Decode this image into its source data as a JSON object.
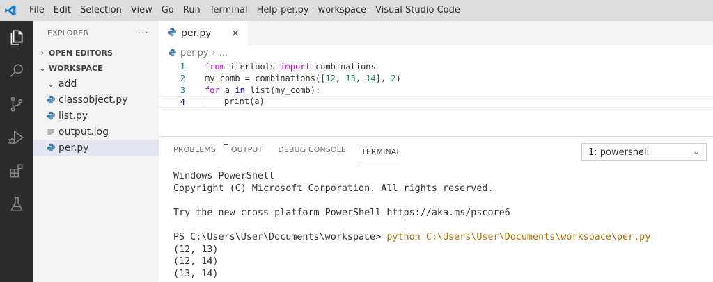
{
  "window": {
    "title": "per.py - workspace - Visual Studio Code",
    "menu": [
      "File",
      "Edit",
      "Selection",
      "View",
      "Go",
      "Run",
      "Terminal",
      "Help"
    ]
  },
  "activity_bar": {
    "icons": [
      "explorer-icon",
      "search-icon",
      "source-control-icon",
      "run-debug-icon",
      "extensions-icon",
      "testing-icon"
    ]
  },
  "sidebar": {
    "title": "EXPLORER",
    "more": "···",
    "open_editors": "OPEN EDITORS",
    "workspace": "WORKSPACE",
    "items": [
      {
        "label": "add",
        "kind": "folder"
      },
      {
        "label": "classobject.py",
        "kind": "python"
      },
      {
        "label": "list.py",
        "kind": "python"
      },
      {
        "label": "output.log",
        "kind": "log"
      },
      {
        "label": "per.py",
        "kind": "python",
        "selected": true
      }
    ]
  },
  "editor": {
    "tab": {
      "label": "per.py",
      "close": "×"
    },
    "breadcrumb": {
      "file": "per.py",
      "rest": "..."
    },
    "lines": [
      {
        "n": "1",
        "tokens": [
          [
            "kw-flow",
            "from"
          ],
          [
            "",
            " itertools "
          ],
          [
            "kw-flow",
            "import"
          ],
          [
            "",
            " combinations"
          ]
        ]
      },
      {
        "n": "2",
        "tokens": [
          [
            "",
            "my_comb = combinations(["
          ],
          [
            "num",
            "12"
          ],
          [
            "",
            ", "
          ],
          [
            "num",
            "13"
          ],
          [
            "",
            ", "
          ],
          [
            "num",
            "14"
          ],
          [
            "",
            "], "
          ],
          [
            "num",
            "2"
          ],
          [
            "",
            ")"
          ]
        ]
      },
      {
        "n": "3",
        "tokens": [
          [
            "kw-flow",
            "for"
          ],
          [
            "",
            " a "
          ],
          [
            "kw",
            "in"
          ],
          [
            "",
            " list(my_comb):"
          ]
        ]
      },
      {
        "n": "4",
        "tokens": [
          [
            "indent",
            ""
          ],
          [
            "",
            "print(a)"
          ]
        ]
      }
    ]
  },
  "panel": {
    "tabs": [
      "PROBLEMS",
      "OUTPUT",
      "DEBUG CONSOLE",
      "TERMINAL"
    ],
    "active_tab": "TERMINAL",
    "terminal_select": "1: powershell",
    "terminal_lines": [
      {
        "text": "Windows PowerShell"
      },
      {
        "text": "Copyright (C) Microsoft Corporation. All rights reserved."
      },
      {
        "text": ""
      },
      {
        "text": "Try the new cross-platform PowerShell https://aka.ms/pscore6"
      },
      {
        "text": ""
      },
      {
        "prompt": "PS C:\\Users\\User\\Documents\\workspace> ",
        "cmd": "python C:\\Users\\User\\Documents\\workspace\\per.py"
      },
      {
        "text": "(12, 13)"
      },
      {
        "text": "(12, 14)"
      },
      {
        "text": "(13, 14)"
      }
    ]
  },
  "colors": {
    "accent_blue": "#007acc",
    "activity_bar_bg": "#2c2c2c",
    "sidebar_bg": "#f3f3f3",
    "python_icon": "#3b77a8"
  }
}
